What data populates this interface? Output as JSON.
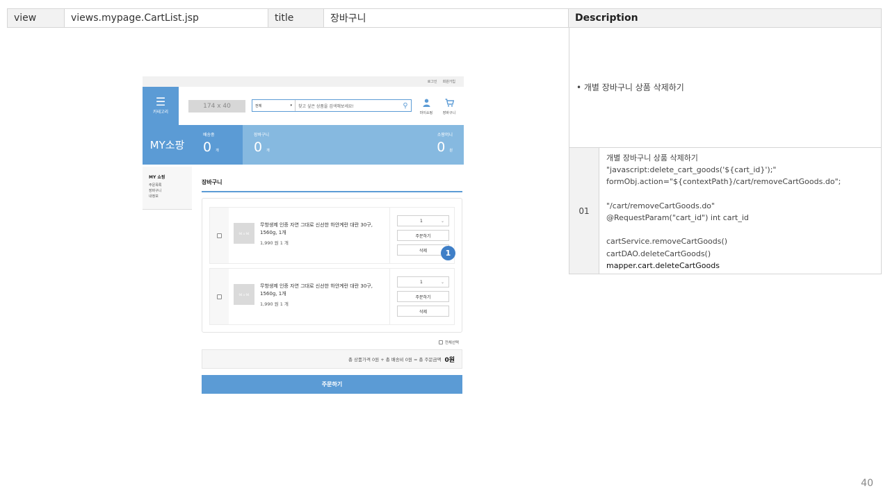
{
  "spec": {
    "view_label": "view",
    "view_value": "views.mypage.CartList.jsp",
    "title_label": "title",
    "title_value": "장바구니",
    "description_label": "Description"
  },
  "description": {
    "bullet": "• 개별 장바구니 상품 삭제하기",
    "row_number": "01",
    "lines": [
      "개별 장바구니 상품 삭제하기",
      "\"javascript:delete_cart_goods('${cart_id}');\"",
      "formObj.action=\"${contextPath}/cart/removeCartGoods.do\";",
      "",
      "\"/cart/removeCartGoods.do\"",
      "@RequestParam(\"cart_id\") int cart_id",
      "",
      "cartService.removeCartGoods()",
      "cartDAO.deleteCartGoods()",
      "mapper.cart.deleteCartGoods"
    ]
  },
  "page_number": "40",
  "mockup": {
    "top_links": [
      "로그인",
      "회원가입"
    ],
    "category_label": "카테고리",
    "logo_placeholder": "174 x 40",
    "search": {
      "select_value": "전체",
      "placeholder": "찾고 싶은 상품을 검색해보세요!"
    },
    "icons": [
      {
        "name": "user-icon",
        "label": "마이쇼핑"
      },
      {
        "name": "cart-icon",
        "label": "장바구니"
      }
    ],
    "banner": {
      "title": "MY소팡",
      "stats": [
        {
          "label": "배송중",
          "value": "0",
          "unit": "개"
        },
        {
          "label": "장바구니",
          "value": "0",
          "unit": "개"
        },
        {
          "label": "소팡머니",
          "value": "0",
          "unit": "원"
        }
      ]
    },
    "sidebar": {
      "heading": "MY 쇼핑",
      "items": [
        "주문목록",
        "장바구니",
        "내정보"
      ]
    },
    "cart_title": "장바구니",
    "items": [
      {
        "thumb_label": "94 x 94",
        "name": "무항생제 인증 자연 그대로 신선한 하얀계란 대란 30구, 1560g, 1개",
        "price": "1,990 원  1 개",
        "qty": "1",
        "order_label": "주문하기",
        "delete_label": "삭제"
      },
      {
        "thumb_label": "94 x 94",
        "name": "무항생제 인증 자연 그대로 신선한 하얀계란 대란 30구, 1560g, 1개",
        "price": "1,990 원  1 개",
        "qty": "1",
        "order_label": "주문하기",
        "delete_label": "삭제"
      }
    ],
    "badge": "1",
    "select_all": "전체선택",
    "total_text": "총 상품가격 0원 + 총 배송비 0원 = 총 주문금액",
    "total_amount": "0원",
    "order_button": "주문하기"
  }
}
